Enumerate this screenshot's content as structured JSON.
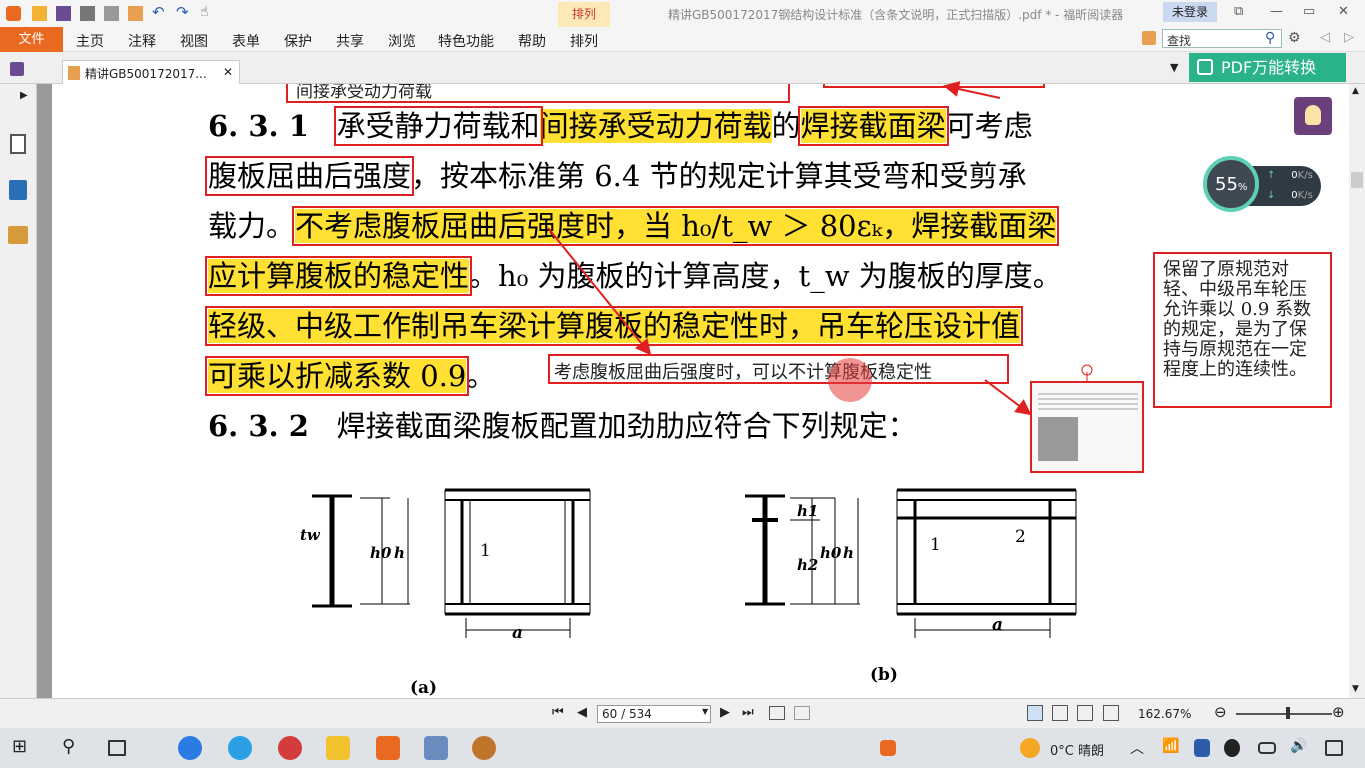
{
  "window": {
    "title": "精讲GB500172017钢结构设计标准（含条文说明，正式扫描版）.pdf * - 福昕阅读器",
    "context_tab": "排列",
    "login": "未登录"
  },
  "ribbon": {
    "file": "文件",
    "menus": [
      "主页",
      "注释",
      "视图",
      "表单",
      "保护",
      "共享",
      "浏览",
      "特色功能",
      "帮助",
      "排列"
    ],
    "search_placeholder": "查找"
  },
  "tabs": {
    "doc_tab": "精讲GB500172017...",
    "pdf_convert": "PDF万能转换"
  },
  "content": {
    "top_note": "间接承受动力荷载",
    "l1_num": "6. 3. 1",
    "l1_a": "承受静力荷载和",
    "l1_b": "间接承受动力荷载",
    "l1_c": "的",
    "l1_d": "焊接截面梁",
    "l1_e": "可考虑",
    "l2_a": "腹板屈曲后强度",
    "l2_b": "，按本标准第 6.4 节的规定计算其受弯和受剪承",
    "l3_a": "载力。",
    "l3_b": "不考虑腹板屈曲后强度时，当 h₀/t_w ＞ 80εₖ，焊接截面梁",
    "l4_a": "应计算腹板的稳定性",
    "l4_b": "。h₀ 为腹板的计算高度，t_w 为腹板的厚度。",
    "l5": "轻级、中级工作制吊车梁计算腹板的稳定性时，吊车轮压设计值",
    "l6": "可乘以折减系数 0.9",
    "l6_tail": "。",
    "l7_num": "6. 3. 2",
    "l7": "焊接截面梁腹板配置加劲肋应符合下列规定：",
    "note1": "考虑腹板屈曲后强度时，可以不计算腹板稳定性",
    "note2": "保留了原规范对轻、中级吊车轮压允许乘以 0.9 系数的规定，是为了保持与原规范在一定程度上的连续性。",
    "fig_a": "(a)",
    "fig_b": "(b)",
    "lbl_tw": "tw",
    "lbl_h0": "h0",
    "lbl_h": "h",
    "lbl_1": "1",
    "lbl_a": "a",
    "lbl_h1": "h1",
    "lbl_h2": "h2",
    "lbl_2": "2"
  },
  "gauge": {
    "percent": "55",
    "unit": "%",
    "up": "0",
    "down": "0",
    "rate_unit": "K/s"
  },
  "status": {
    "page": "60 / 534",
    "zoom": "162.67%"
  },
  "taskbar": {
    "weather": "0°C 晴朗"
  }
}
